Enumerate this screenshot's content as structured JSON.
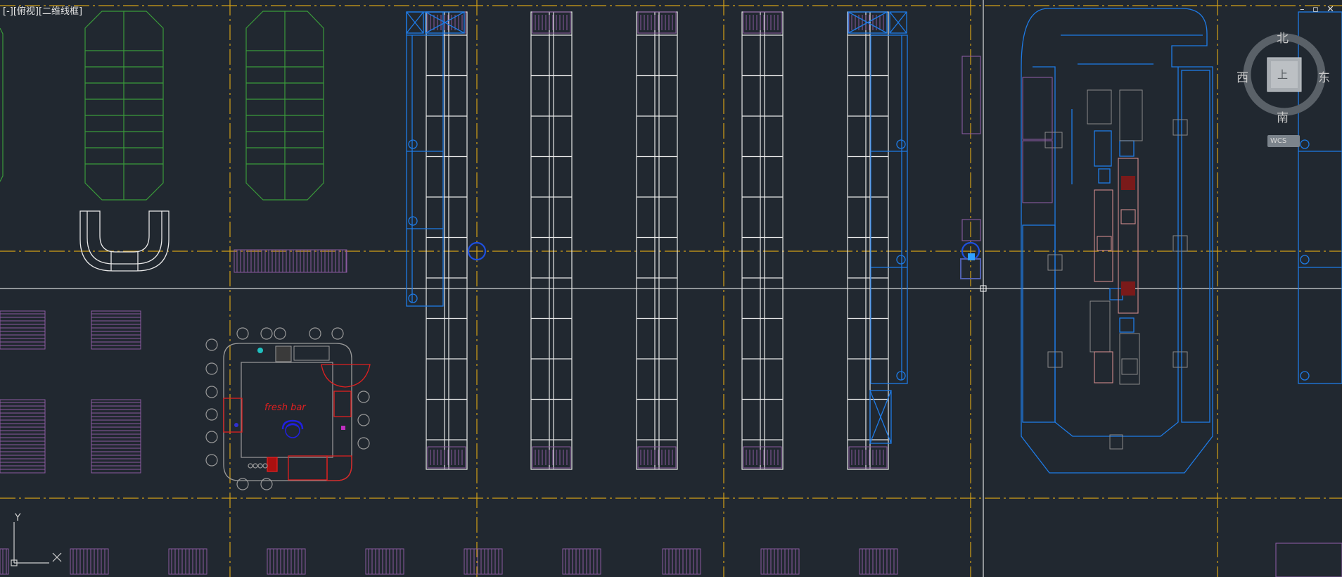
{
  "viewport": {
    "controls_label": "[-][俯视][二维线框]"
  },
  "window_controls": {
    "minimize": "–",
    "restore": "▫",
    "close": "✕"
  },
  "viewcube": {
    "north": "北",
    "south": "南",
    "east": "东",
    "west": "西",
    "face": "上",
    "wcs_label": "WCS"
  },
  "drawing": {
    "fresh_bar_label": "fresh bar"
  },
  "ucs": {
    "y_label": "Y",
    "x_label": "X"
  },
  "colors": {
    "background": "#212830",
    "axis_lines": "#d4a017",
    "fixtures_white": "#e8e8e8",
    "fixtures_blue": "#1e7be6",
    "fixtures_green": "#3a9a3a",
    "fixtures_purple": "#8a5aa0",
    "fixtures_red": "#e02020",
    "fixtures_pink": "#d08a8a",
    "crosshair": "#ffffff"
  }
}
